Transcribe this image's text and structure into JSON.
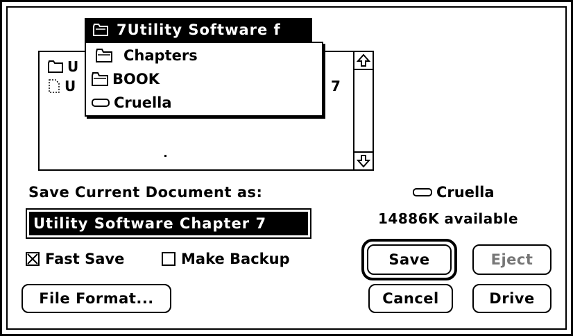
{
  "popup": {
    "current_folder": "7Utility Software f",
    "items": [
      {
        "label": "Chapters",
        "icon": "folder-icon"
      },
      {
        "label": "BOOK",
        "icon": "folder-icon"
      },
      {
        "label": "Cruella",
        "icon": "disk-icon"
      }
    ]
  },
  "file_list": {
    "rows": [
      {
        "prefix": "U",
        "suffix": "",
        "icon": "folder-icon"
      },
      {
        "prefix": "U",
        "suffix": "7",
        "icon": "document-icon"
      }
    ]
  },
  "save_as": {
    "label": "Save Current Document as:",
    "filename": "Utility Software Chapter 7"
  },
  "volume": {
    "name": "Cruella",
    "available": "14886K available"
  },
  "options": {
    "fast_save_label": "Fast Save",
    "fast_save_checked": true,
    "make_backup_label": "Make Backup",
    "make_backup_checked": false
  },
  "buttons": {
    "save": "Save",
    "eject": "Eject",
    "cancel": "Cancel",
    "drive": "Drive",
    "file_format": "File Format..."
  }
}
